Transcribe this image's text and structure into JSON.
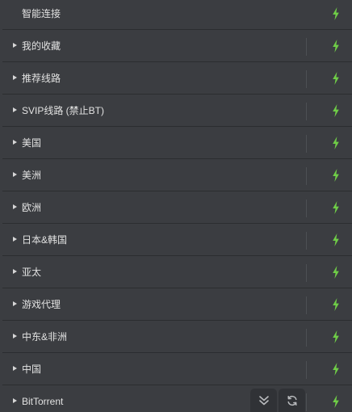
{
  "proxy_groups": [
    {
      "label": "智能连接",
      "expandable": false
    },
    {
      "label": "我的收藏",
      "expandable": true
    },
    {
      "label": "推荐线路",
      "expandable": true
    },
    {
      "label": "SVIP线路 (禁止BT)",
      "expandable": true
    },
    {
      "label": "美国",
      "expandable": true
    },
    {
      "label": "美洲",
      "expandable": true
    },
    {
      "label": "欧洲",
      "expandable": true
    },
    {
      "label": "日本&韩国",
      "expandable": true
    },
    {
      "label": "亚太",
      "expandable": true
    },
    {
      "label": "游戏代理",
      "expandable": true
    },
    {
      "label": "中东&非洲",
      "expandable": true
    },
    {
      "label": "中国",
      "expandable": true
    },
    {
      "label": "BitTorrent",
      "expandable": true
    }
  ],
  "icons": {
    "row_action": "lightning-bolt-icon",
    "expand": "caret-right-icon",
    "collapse_all": "double-chevron-down-icon",
    "refresh": "refresh-icon"
  },
  "colors": {
    "background": "#3b3d41",
    "accent_green": "#6fce47",
    "text": "#e2e2e2"
  }
}
